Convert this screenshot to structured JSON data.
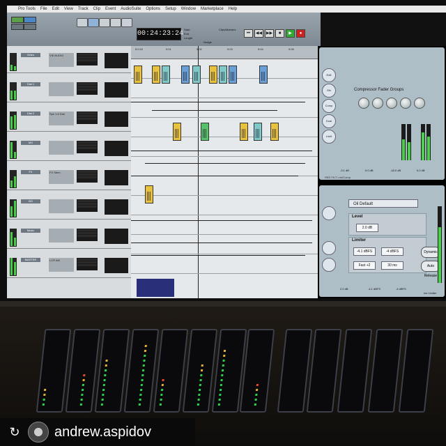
{
  "app": {
    "name": "Pro Tools",
    "menu": [
      "Pro Tools",
      "File",
      "Edit",
      "View",
      "Track",
      "Clip",
      "Event",
      "AudioSuite",
      "Options",
      "Setup",
      "Window",
      "Marketplace",
      "Help"
    ]
  },
  "transport": {
    "counter": "00:24:23:24",
    "start_label": "Start",
    "end_label": "End",
    "length_label": "Length",
    "nudge_label": "Nudge",
    "clips_markers": "Clips/Markers",
    "buttons": [
      "⏮",
      "◀◀",
      "▶▶",
      "■",
      "▶",
      "●"
    ]
  },
  "edit_window": {
    "ruler_marks": [
      "5:0:22",
      "9:01",
      "9:02",
      "9:03",
      "9:04",
      "9:05"
    ],
    "playhead_label": "Markers"
  },
  "tracks": [
    {
      "name": "Video",
      "comment": "VID AUDIO"
    },
    {
      "name": "Dial 1",
      "comment": ""
    },
    {
      "name": "Dial 2",
      "comment": "Spk 1-6 Dial"
    },
    {
      "name": "MX",
      "comment": ""
    },
    {
      "name": "FX",
      "comment": "FX Stem"
    },
    {
      "name": "BG",
      "comment": ""
    },
    {
      "name": "Music",
      "comment": ""
    },
    {
      "name": "MASTER",
      "comment": "LCR AM"
    }
  ],
  "plugins": {
    "compressor": {
      "title": "Compressor Fader Groups",
      "tabs": [
        "Edit",
        "Gfx",
        "Comp",
        "Dual",
        "Limit"
      ],
      "readouts": [
        "-3.1 dB",
        "0.0 dB",
        "-18.0 dB",
        "0.0 dB"
      ],
      "footer": "RED FILT Lmt/Comp"
    },
    "limiter": {
      "preset": "Oil Default",
      "level_label": "Level",
      "limiter_label": "Limiter",
      "threshold": "2.0 dB",
      "release": "-4.1 dBFS",
      "ceiling": "-4 dBFS",
      "auto_label": "Auto Release",
      "dynamic_label": "Dynamic",
      "fast_label": "Fast +2",
      "time_label": "30 ms",
      "bottom_values": [
        "2.0 dB",
        "-4.1 dBFS",
        "-4 dBFS"
      ],
      "footer": "Ice Limiter"
    }
  },
  "colors": {
    "clip_yellow": "#e8c23c",
    "clip_teal": "#7fc9c8",
    "clip_blue": "#6aa0d8",
    "clip_green": "#58c26a",
    "meter_green": "#2ad14b",
    "meter_red": "#e84a2a"
  },
  "footer": {
    "repost_icon": "↻",
    "username": "andrew.aspidov"
  }
}
